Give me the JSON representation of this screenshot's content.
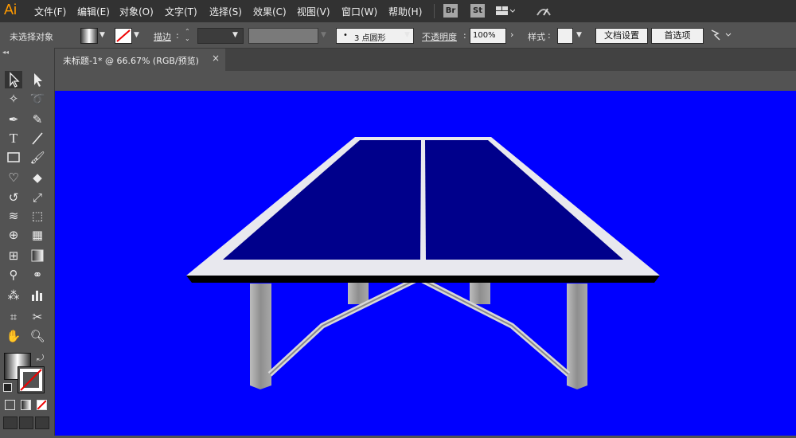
{
  "app": {
    "logo": "Ai"
  },
  "menu": [
    "文件(F)",
    "编辑(E)",
    "对象(O)",
    "文字(T)",
    "选择(S)",
    "效果(C)",
    "视图(V)",
    "窗口(W)",
    "帮助(H)"
  ],
  "app_badges": {
    "bridge": "Br",
    "stock": "St"
  },
  "control": {
    "selection_status": "未选择对象",
    "stroke_label": "描边",
    "brush_value": "3 点圆形",
    "opacity_label": "不透明度",
    "opacity_value": "100%",
    "style_label": "样式",
    "doc_setup": "文档设置",
    "preferences": "首选项"
  },
  "document": {
    "tab_title": "未标题-1* @ 66.67% (RGB/预览)",
    "close": "×"
  },
  "colors": {
    "canvas": "#0000ff",
    "table_top": "#00008b",
    "table_border": "#e8e8ee",
    "legs": "#9a9a9a"
  },
  "tools": [
    "selection-tool",
    "direct-selection-tool",
    "magic-wand-tool",
    "lasso-tool",
    "pen-tool",
    "curvature-tool",
    "type-tool",
    "line-tool",
    "rectangle-tool",
    "paintbrush-tool",
    "shaper-tool",
    "eraser-tool",
    "rotate-tool",
    "scale-tool",
    "warp-tool",
    "free-transform-tool",
    "shape-builder-tool",
    "perspective-grid-tool",
    "mesh-tool",
    "gradient-tool",
    "eyedropper-tool",
    "blend-tool",
    "symbol-sprayer-tool",
    "column-graph-tool",
    "artboard-tool",
    "slice-tool",
    "hand-tool",
    "zoom-tool"
  ]
}
